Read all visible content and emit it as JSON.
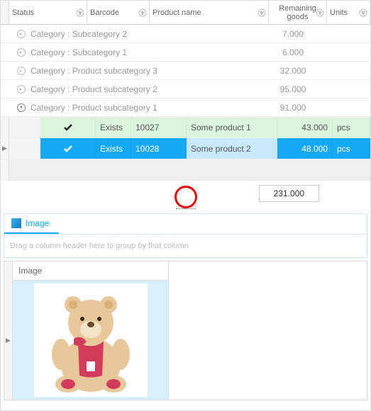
{
  "columns": {
    "status": "Status",
    "barcode": "Barcode",
    "product": "Product name",
    "remaining": "Remaining goods",
    "units": "Units"
  },
  "groups": [
    {
      "label": "Category : Subcategory 2",
      "value": "7.000",
      "expanded": false
    },
    {
      "label": "Category : Subcategory 1",
      "value": "6.000",
      "expanded": false
    },
    {
      "label": "Category : Product subcategory 3",
      "value": "32.000",
      "expanded": false
    },
    {
      "label": "Category : Product subcategory 2",
      "value": "95.000",
      "expanded": false
    },
    {
      "label": "Category : Product subcategory 1",
      "value": "91.000",
      "expanded": true
    }
  ],
  "rows": [
    {
      "status": "Exists",
      "barcode": "10027",
      "product": "Some product 1",
      "remaining": "43.000",
      "units": "pcs",
      "selected": false
    },
    {
      "status": "Exists",
      "barcode": "10028",
      "product": "Some product 2",
      "remaining": "48.000",
      "units": "pcs",
      "selected": true
    }
  ],
  "total": "231.000",
  "detail": {
    "tab": "Image",
    "dropHint": "Drag a column header here to group by that column",
    "col": "Image"
  }
}
